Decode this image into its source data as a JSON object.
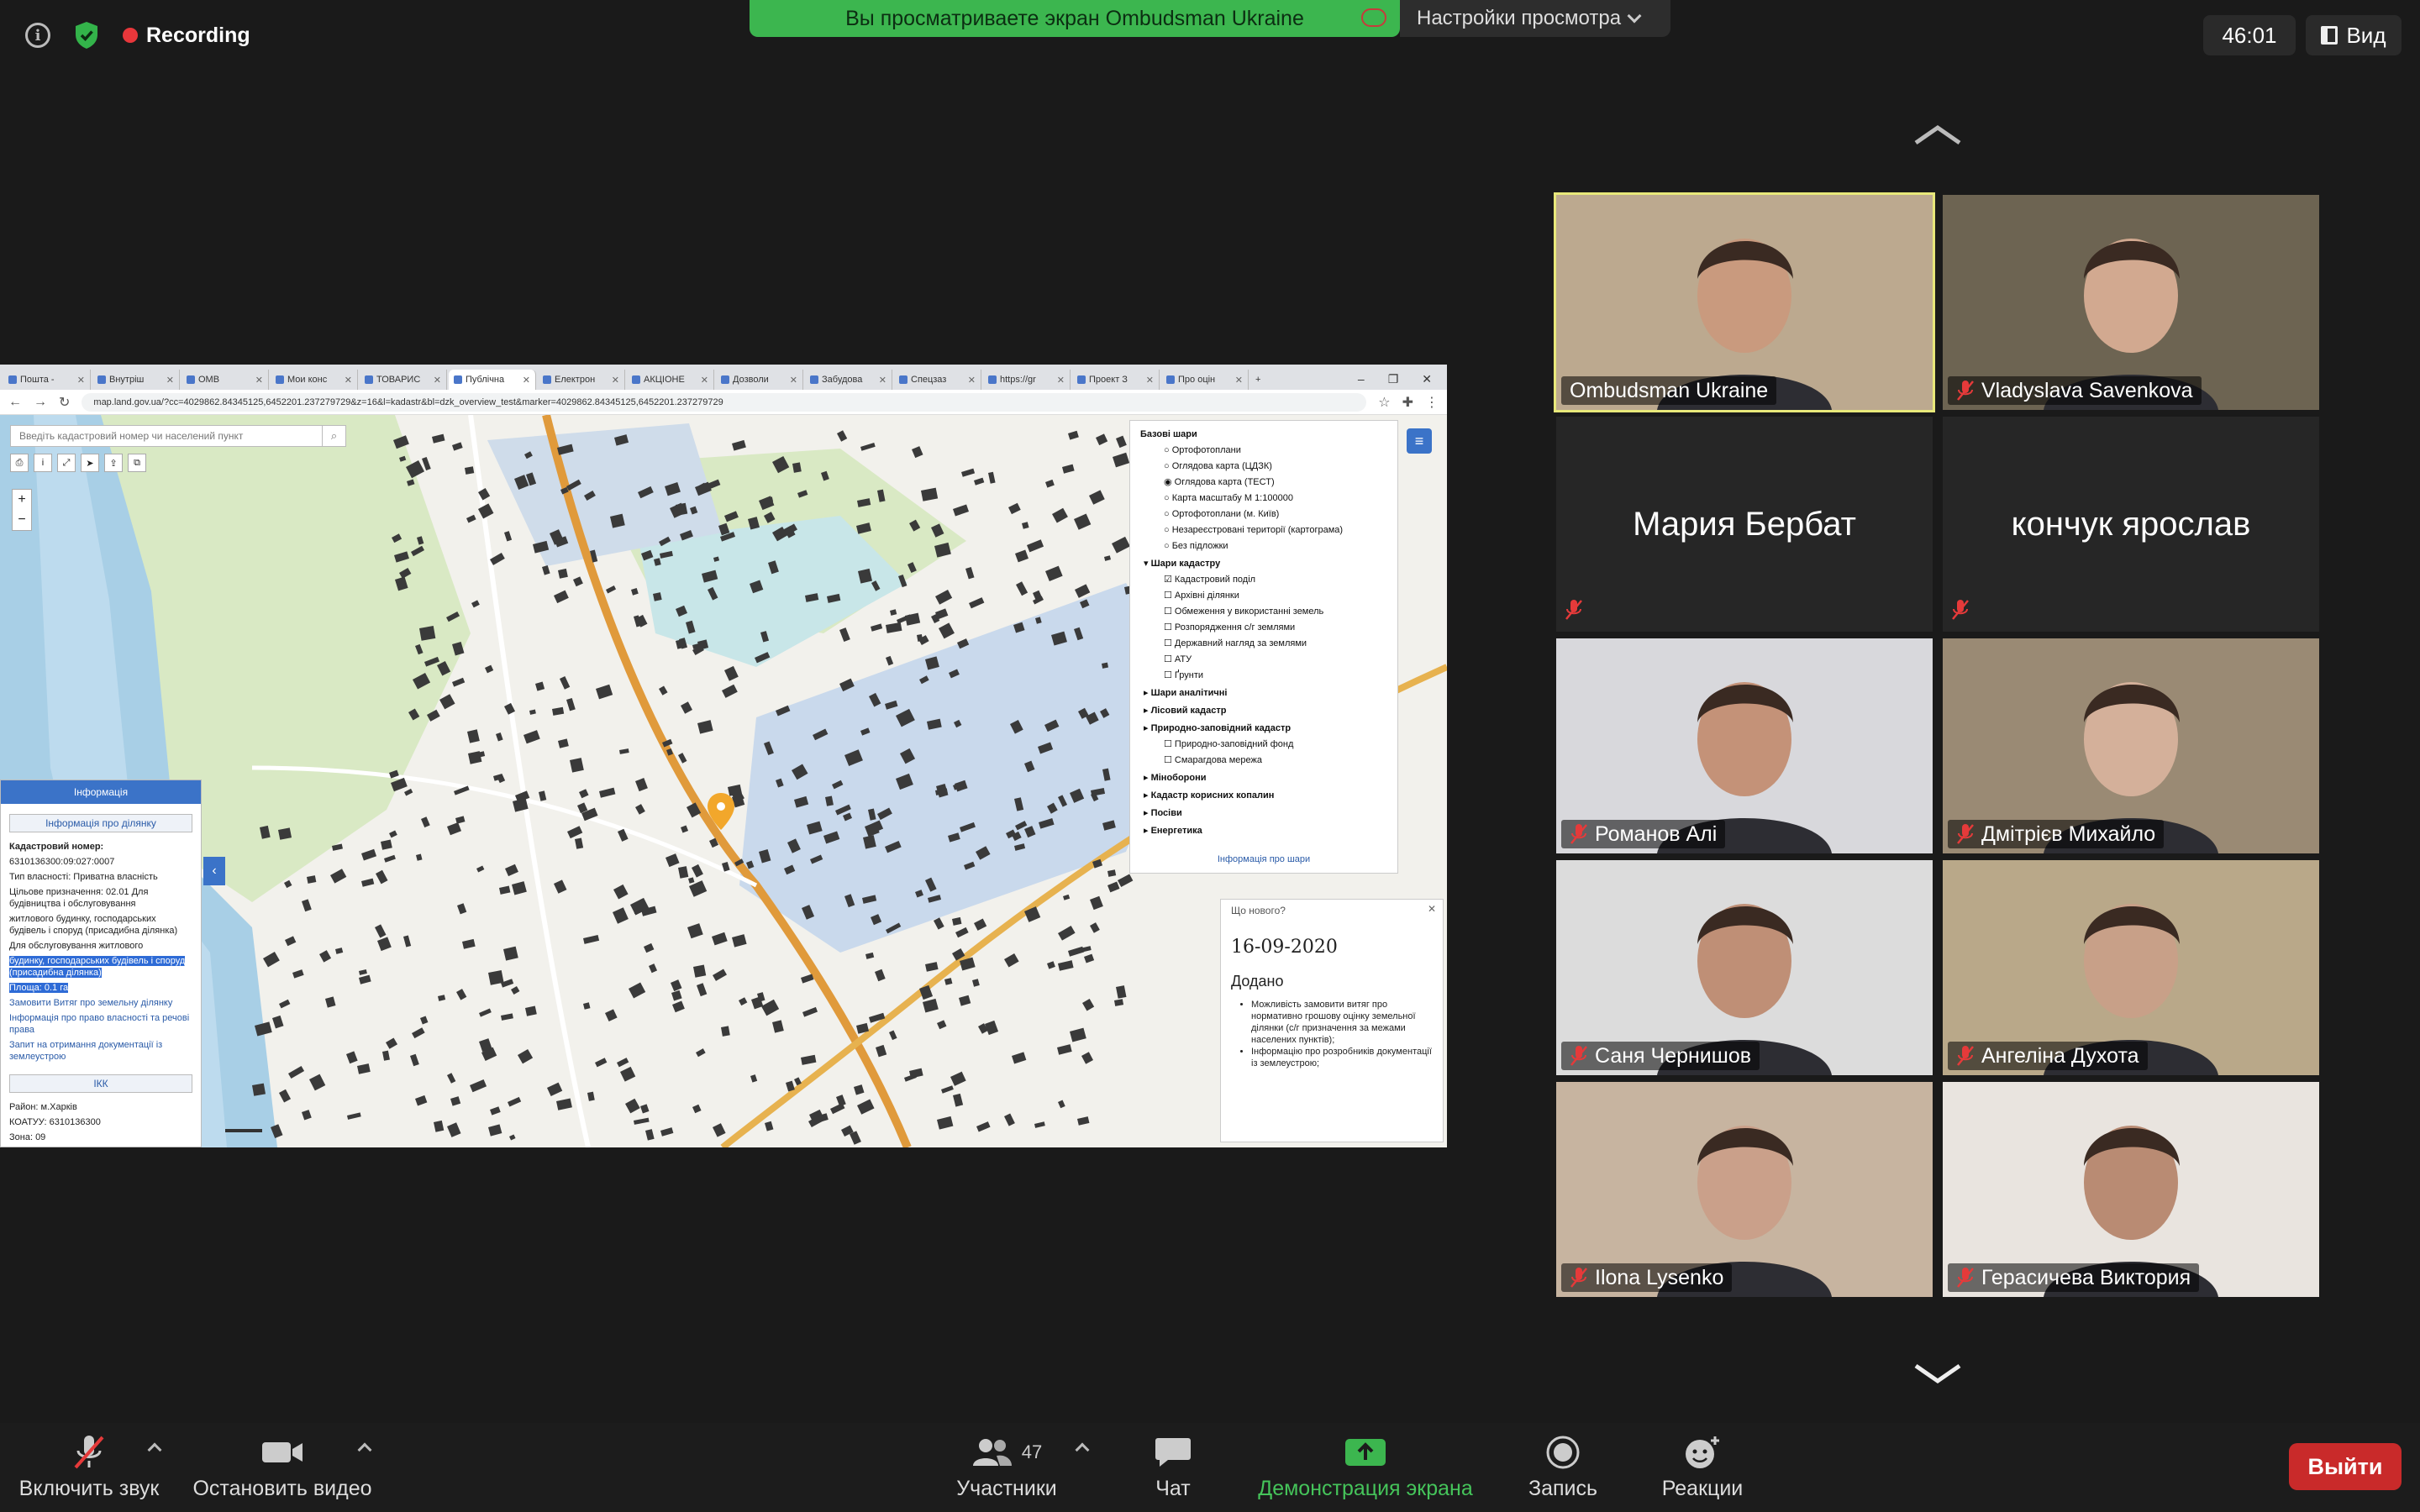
{
  "top": {
    "recording_label": "Recording",
    "share_banner": "Вы просматриваете экран Ombudsman Ukraine",
    "view_settings_label": "Настройки просмотра",
    "timer": "46:01",
    "view_label": "Вид"
  },
  "browser": {
    "tabs": [
      "Пошта -",
      "Внутріш",
      "ОМВ",
      "Мои конс",
      "ТОВАРИС",
      "Публічна",
      "Електрон",
      "АКЦІОНЕ",
      "Дозволи",
      "Забудова",
      "Спецзаз",
      "https://gr",
      "Проект З",
      "Про оцін"
    ],
    "active_tab_index": 5,
    "url": "map.land.gov.ua/?cc=4029862.84345125,6452201.237279729&z=16&l=kadastr&bl=dzk_overview_test&marker=4029862.84345125,6452201.237279729",
    "search_placeholder": "Введіть кадастровий номер чи населений пункт"
  },
  "info_panel": {
    "title": "Інформація",
    "subtitle": "Інформація про ділянку",
    "cad_label": "Кадастровий номер:",
    "cad_value": "6310136300:09:027:0007",
    "ownership": "Тип власності: Приватна власність",
    "purpose_1": "Цільове призначення: 02.01 Для будівництва і обслуговування",
    "purpose_2": "житлового будинку, господарських будівель і споруд (присадибна ділянка)",
    "purpose_3": "Для обслуговування житлового",
    "purpose_hl": "будинку, господарських будівель і споруд (присадибна ділянка)",
    "area": "Площа: 0.1 га",
    "link_1": "Замовити Витяг про земельну ділянку",
    "link_2": "Інформація про право власності та речові права",
    "link_3": "Запит на отримання документації із землеустрою",
    "ikk": "ІКК",
    "district": "Район: м.Харків",
    "koatuu": "КОАТУУ: 6310136300",
    "zone": "Зона: 09"
  },
  "layers": {
    "base_header": "Базові шари",
    "base_items": [
      "Ортофотоплани",
      "Оглядова карта (ЦДЗК)",
      "Оглядова карта (ТЕСТ)",
      "Карта масштабу М 1:100000",
      "Ортофотоплани (м. Київ)",
      "Незареєстровані території (картограма)",
      "Без підложки"
    ],
    "cad_header": "Шари кадастру",
    "cad_items": [
      "Кадастровий поділ",
      "Архівні ділянки",
      "Обмеження у використанні земель",
      "Розпорядження с/г землями",
      "Державний нагляд за землями",
      "АТУ",
      "Ґрунти"
    ],
    "sections": [
      "Шари аналітичні",
      "Лісовий кадастр",
      "Природно-заповідний кадастр"
    ],
    "nature_items": [
      "Природно-заповідний фонд",
      "Смарагдова мережа"
    ],
    "sections_2": [
      "Міноборони",
      "Кадастр корисних копалин",
      "Посіви",
      "Енергетика"
    ],
    "footer": "Інформація про шари"
  },
  "news": {
    "header": "Що нового?",
    "date": "16-09-2020",
    "added": "Додано",
    "item_1": "Можливість замовити витяг про нормативно грошову оцінку земельної ділянки (с/г призначення за межами населених пунктів);",
    "item_2": "Інформацію про розробників документації із землеустрою;"
  },
  "participants": [
    {
      "name": "Ombudsman Ukraine",
      "muted": false,
      "video": true,
      "speaking": true
    },
    {
      "name": "Vladyslava Savenkova",
      "muted": true,
      "video": true
    },
    {
      "name": "Мария Бербат",
      "muted": true,
      "video": false
    },
    {
      "name": "кончук ярослав",
      "muted": true,
      "video": false
    },
    {
      "name": "Романов Алі",
      "muted": true,
      "video": true
    },
    {
      "name": "Дмітрієв Михайло",
      "muted": true,
      "video": true
    },
    {
      "name": "Саня Чернишов",
      "muted": true,
      "video": true
    },
    {
      "name": "Ангеліна Духота",
      "muted": true,
      "video": true
    },
    {
      "name": "Ilona Lysenko",
      "muted": true,
      "video": true
    },
    {
      "name": "Герасичева Виктория",
      "muted": true,
      "video": true
    }
  ],
  "toolbar": {
    "mute_label": "Включить звук",
    "video_label": "Остановить видео",
    "participants_label": "Участники",
    "participants_count": "47",
    "chat_label": "Чат",
    "share_label": "Демонстрация экрана",
    "record_label": "Запись",
    "reactions_label": "Реакции",
    "leave_label": "Выйти"
  },
  "colors": {
    "share_green": "#3cb64f",
    "speaker_outline": "#e8e87a",
    "leave_red": "#c92a2a",
    "rec_red": "#e8373b"
  }
}
